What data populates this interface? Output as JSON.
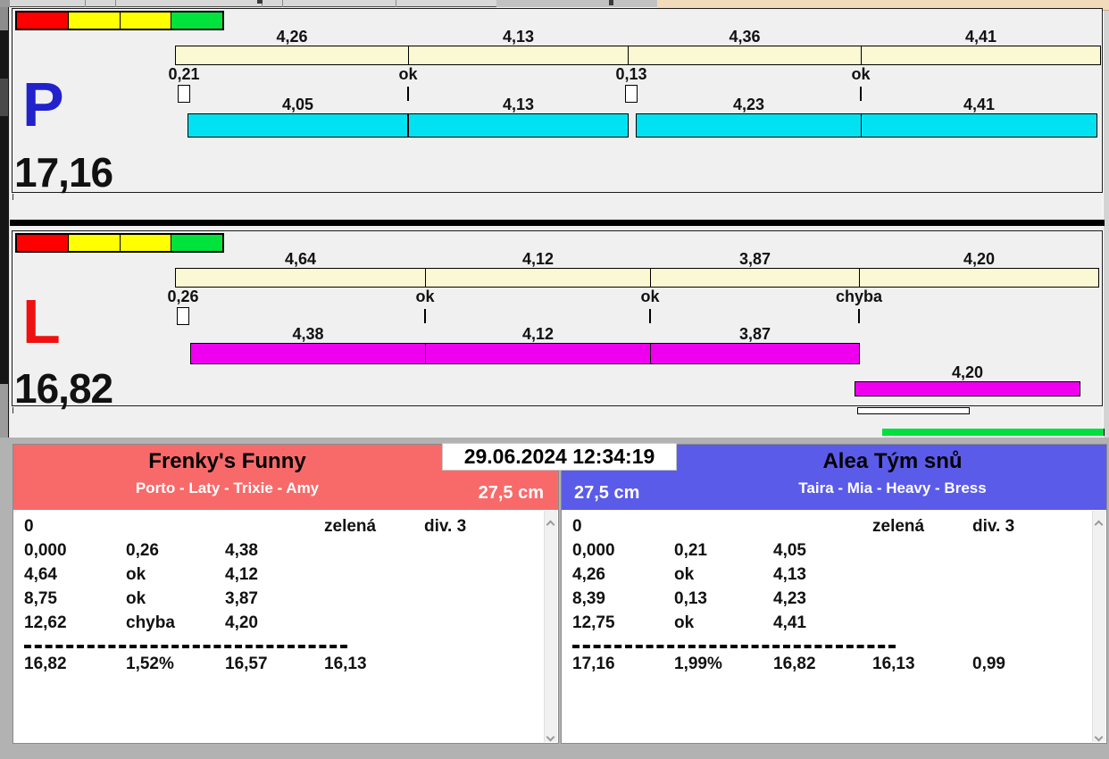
{
  "colors": {
    "indicator_segments": [
      "#ff0000",
      "#ffff00",
      "#ffff00",
      "#00e33c"
    ],
    "split_bar": "#fbf8d4",
    "p_time_bar": "#00e2f2",
    "l_time_bar": "#ee00ee",
    "p_label": "#2222cc",
    "l_label": "#ee1111",
    "left_team_header": "#f86a6a",
    "right_team_header": "#5b5be9",
    "green_progress_bar": "#00df3e",
    "top_edge": "#f1dbbb"
  },
  "run_p": {
    "label": "P",
    "total": "17,16",
    "split_bar": [
      "4,26",
      "4,13",
      "4,36",
      "4,41"
    ],
    "markers": [
      "0,21",
      "ok",
      "0,13",
      "ok"
    ],
    "time_bar": [
      "4,05",
      "4,13",
      "4,23",
      "4,41"
    ]
  },
  "run_l": {
    "label": "L",
    "total": "16,82",
    "split_bar": [
      "4,64",
      "4,12",
      "3,87",
      "4,20"
    ],
    "markers": [
      "0,26",
      "ok",
      "ok",
      "chyba"
    ],
    "time_bar": [
      "4,38",
      "4,12",
      "3,87"
    ],
    "extra_time": "4,20"
  },
  "datetime": "29.06.2024 12:34:19",
  "team_left": {
    "name": "Frenky's Funny",
    "members": "Porto - Laty - Trixie - Amy",
    "category": "27,5 cm",
    "info_row": {
      "c1": "0",
      "c4": "zelená",
      "c5": "div. 3"
    },
    "rows": [
      {
        "c1": "0,000",
        "c2": "0,26",
        "c3": "4,38"
      },
      {
        "c1": "4,64",
        "c2": "ok",
        "c3": "4,12"
      },
      {
        "c1": "8,75",
        "c2": "ok",
        "c3": "3,87"
      },
      {
        "c1": "12,62",
        "c2": "chyba",
        "c3": "4,20"
      }
    ],
    "total_row": {
      "c1": "16,82",
      "c2": "1,52%",
      "c3": "16,57",
      "c4": "16,13",
      "c5": ""
    }
  },
  "team_right": {
    "name": "Alea Tým snů",
    "members": "Taira - Mia - Heavy - Bress",
    "category": "27,5 cm",
    "info_row": {
      "c1": "0",
      "c4": "zelená",
      "c5": "div. 3"
    },
    "rows": [
      {
        "c1": "0,000",
        "c2": "0,21",
        "c3": "4,05"
      },
      {
        "c1": "4,26",
        "c2": "ok",
        "c3": "4,13"
      },
      {
        "c1": "8,39",
        "c2": "0,13",
        "c3": "4,23"
      },
      {
        "c1": "12,75",
        "c2": "ok",
        "c3": "4,41"
      }
    ],
    "total_row": {
      "c1": "17,16",
      "c2": "1,99%",
      "c3": "16,82",
      "c4": "16,13",
      "c5": "0,99"
    }
  }
}
